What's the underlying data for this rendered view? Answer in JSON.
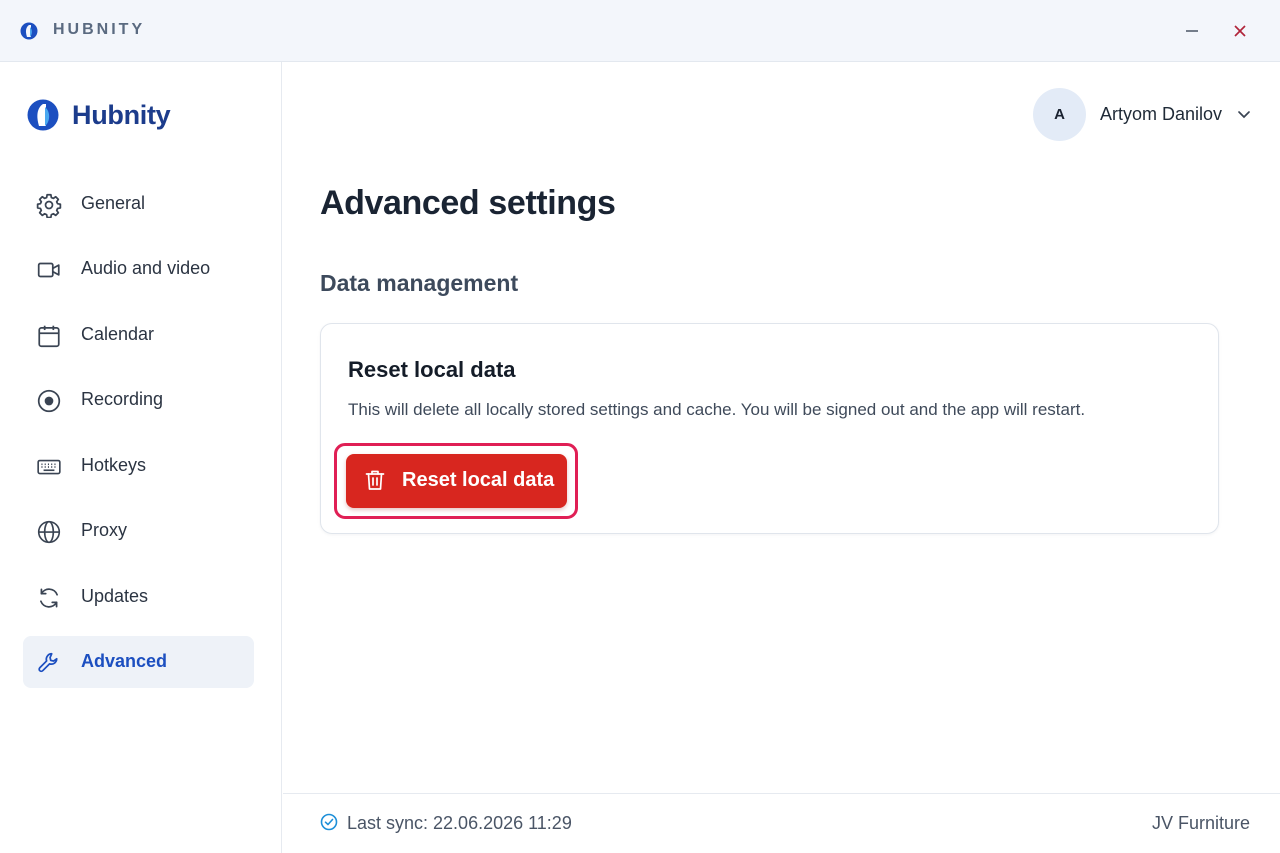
{
  "window": {
    "title": "HUBNITY",
    "minimize_icon": "minimize-icon",
    "close_icon": "close-icon"
  },
  "sidebar": {
    "brand": "Hubnity",
    "items": [
      {
        "label": "General",
        "icon": "gear-icon"
      },
      {
        "label": "Audio and video",
        "icon": "video-camera-icon"
      },
      {
        "label": "Calendar",
        "icon": "calendar-icon"
      },
      {
        "label": "Recording",
        "icon": "record-icon"
      },
      {
        "label": "Hotkeys",
        "icon": "keyboard-icon"
      },
      {
        "label": "Proxy",
        "icon": "globe-icon"
      },
      {
        "label": "Updates",
        "icon": "refresh-icon"
      },
      {
        "label": "Advanced",
        "icon": "wrench-icon",
        "active": true
      }
    ]
  },
  "header": {
    "avatar_initial": "A",
    "user_name": "Artyom Danilov"
  },
  "main": {
    "title": "Advanced settings",
    "section": "Data management",
    "card": {
      "title": "Reset local data",
      "description": "This will delete all locally stored settings and cache. You will be signed out and the app will restart.",
      "button_label": "Reset local data"
    }
  },
  "footer": {
    "sync_text": "Last sync: 22.06.2026 11:29",
    "org": "JV Furniture"
  },
  "colors": {
    "brand_blue": "#1c3c8c",
    "accent_blue": "#1c4fc0",
    "danger_red": "#d8261f",
    "focus_ring": "#e01f55",
    "sync_check": "#1d8fd8"
  }
}
